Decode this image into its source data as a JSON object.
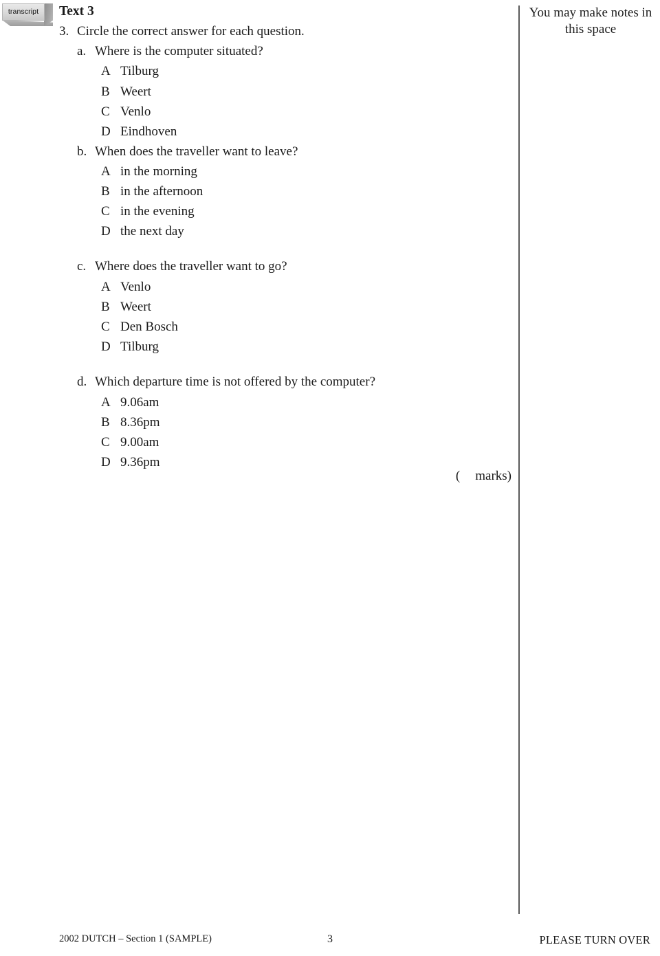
{
  "badge": {
    "label": "transcript",
    "icon": "transcript-button-icon"
  },
  "notes": {
    "heading": "You may make notes in this space"
  },
  "document": {
    "text_heading": "Text 3",
    "question_number": "3.",
    "question_stem": "Circle the correct answer for each question.",
    "sub_questions": [
      {
        "letter": "a.",
        "prompt": "Where is the computer situated?",
        "options": [
          {
            "letter": "A",
            "text": "Tilburg"
          },
          {
            "letter": "B",
            "text": "Weert"
          },
          {
            "letter": "C",
            "text": "Venlo"
          },
          {
            "letter": "D",
            "text": "Eindhoven"
          }
        ]
      },
      {
        "letter": "b.",
        "prompt": "When does the traveller want to leave?",
        "options": [
          {
            "letter": "A",
            "text": "in the morning"
          },
          {
            "letter": "B",
            "text": "in the afternoon"
          },
          {
            "letter": "C",
            "text": "in the evening"
          },
          {
            "letter": "D",
            "text": "the next day"
          }
        ]
      },
      {
        "letter": "c.",
        "prompt": "Where does the traveller want to go?",
        "options": [
          {
            "letter": "A",
            "text": "Venlo"
          },
          {
            "letter": "B",
            "text": "Weert"
          },
          {
            "letter": "C",
            "text": "Den Bosch"
          },
          {
            "letter": "D",
            "text": "Tilburg"
          }
        ]
      },
      {
        "letter": "d.",
        "prompt": "Which departure time is not offered by the computer?",
        "options": [
          {
            "letter": "A",
            "text": "9.06am"
          },
          {
            "letter": "B",
            "text": "8.36pm"
          },
          {
            "letter": "C",
            "text": "9.00am"
          },
          {
            "letter": "D",
            "text": "9.36pm"
          }
        ]
      }
    ],
    "marks": {
      "open_paren": "(",
      "value": "",
      "label": "marks)"
    }
  },
  "footer": {
    "left": "2002 DUTCH – Section 1 (SAMPLE)",
    "page_number": "3",
    "right": "PLEASE TURN OVER"
  }
}
